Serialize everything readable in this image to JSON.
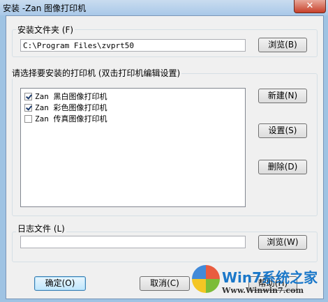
{
  "window": {
    "title": "安装 -Zan 图像打印机",
    "close_glyph": "✕"
  },
  "install_folder": {
    "label": "安装文件夹 (F)",
    "path": "C:\\Program Files\\zvprt50",
    "browse_label": "浏览(B)"
  },
  "printers": {
    "label": "请选择要安装的打印机 (双击打印机编辑设置)",
    "items": [
      {
        "label": "Zan 黑白图像打印机",
        "checked": true
      },
      {
        "label": "Zan 彩色图像打印机",
        "checked": true
      },
      {
        "label": "Zan 传真图像打印机",
        "checked": false
      }
    ],
    "new_label": "新建(N)",
    "settings_label": "设置(S)",
    "delete_label": "删除(D)"
  },
  "log_file": {
    "label": "日志文件 (L)",
    "path": "",
    "browse_label": "浏览(W)"
  },
  "footer": {
    "ok_label": "确定(O)",
    "cancel_label": "取消(C)",
    "help_label": "帮助(H)"
  },
  "watermark": {
    "brand": "Win7系统之家",
    "url": "Www.Winwin7.com"
  }
}
